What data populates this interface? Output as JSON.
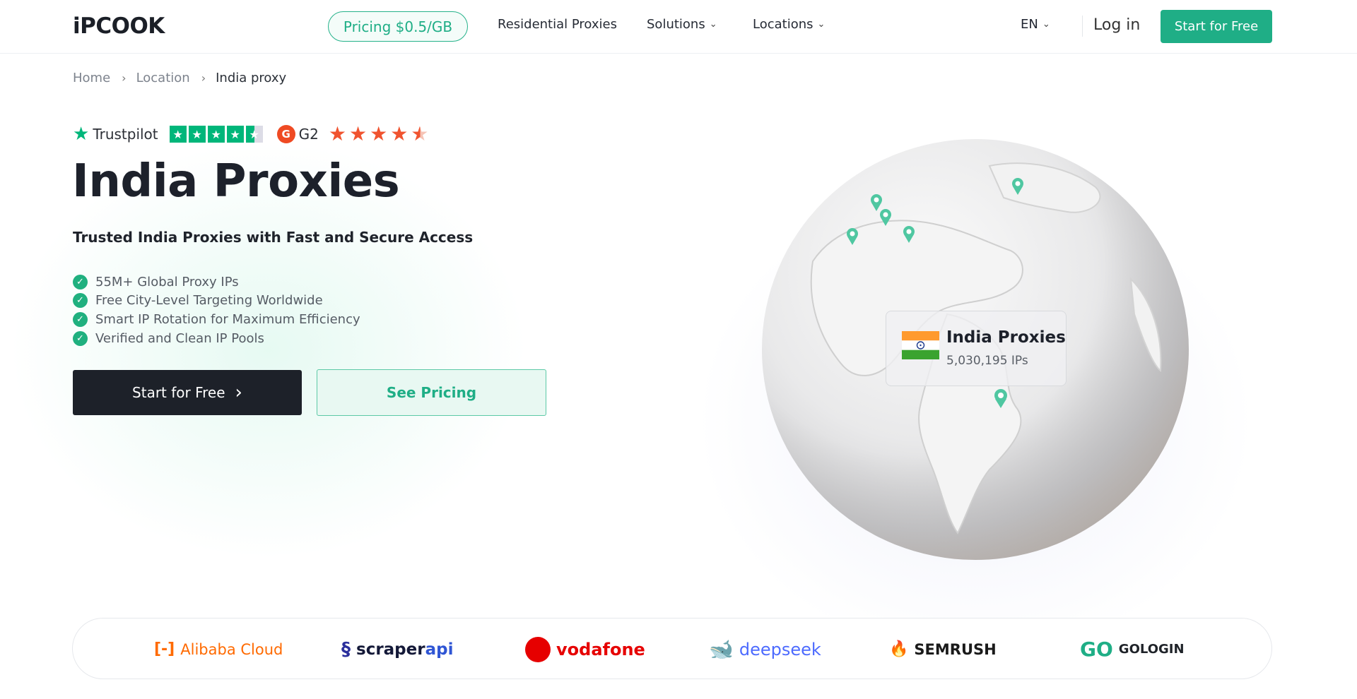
{
  "header": {
    "logo": "iPCOOK",
    "pricing_pill": "Pricing $0.5/GB",
    "nav": [
      "Residential Proxies",
      "Solutions",
      "Locations"
    ],
    "lang": "EN",
    "login": "Log in",
    "cta": "Start for Free"
  },
  "breadcrumb": [
    "Home",
    "Location",
    "India proxy"
  ],
  "ratings": {
    "trustpilot": "Trustpilot",
    "trustpilot_rating": 4.5,
    "g2": "G2",
    "g2_logo": "G",
    "g2_rating": 4.5
  },
  "hero": {
    "title": "India Proxies",
    "subtitle": "Trusted India Proxies with Fast and Secure Access",
    "features": [
      "55M+ Global Proxy IPs",
      "Free City-Level Targeting Worldwide",
      "Smart IP Rotation for Maximum Efficiency",
      "Verified and Clean IP Pools"
    ],
    "primary_button": "Start for Free",
    "secondary_button": "See Pricing"
  },
  "globe_card": {
    "title": "India Proxies",
    "ips": "5,030,195 IPs"
  },
  "partners": [
    {
      "name": "Alibaba Cloud",
      "color": "#ff6a00"
    },
    {
      "name_a": "scraper",
      "name_b": "api",
      "color": "#1a1f6b"
    },
    {
      "name": "vodafone",
      "color": "#e60000"
    },
    {
      "name": "deepseek",
      "color": "#4d6bfe"
    },
    {
      "name": "SEMRUSH",
      "color": "#ff642d"
    },
    {
      "name": "GOLOGIN",
      "color": "#1f2329"
    }
  ],
  "colors": {
    "accent": "#1fae86",
    "dark": "#1d2129",
    "trustpilot": "#00b67a",
    "g2": "#f0532f"
  }
}
